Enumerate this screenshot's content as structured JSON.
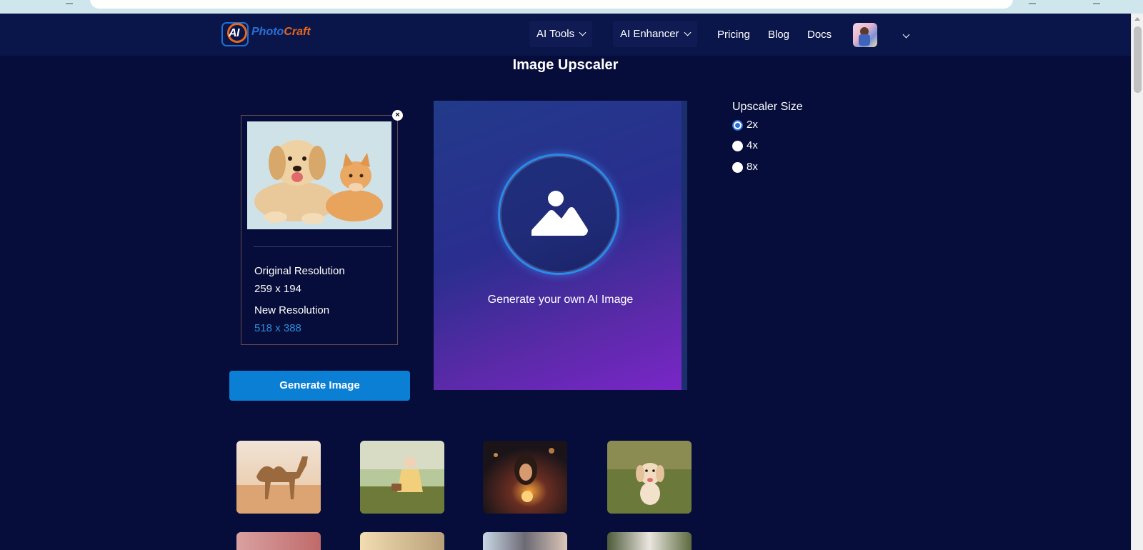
{
  "nav": {
    "logo_ai": "AI",
    "logo_photo": "Photo",
    "logo_craft": "Craft",
    "ai_tools": "AI Tools",
    "ai_enhancer": "AI Enhancer",
    "pricing": "Pricing",
    "blog": "Blog",
    "docs": "Docs"
  },
  "page": {
    "title": "Image Upscaler"
  },
  "upload_card": {
    "close_glyph": "×",
    "original_label": "Original Resolution",
    "original_value": "259 x 194",
    "new_label": "New Resolution",
    "new_value": "518 x 388",
    "new_value_color": "#2d8bd8"
  },
  "generate_button": "Generate Image",
  "preview": {
    "text": "Generate your own AI Image"
  },
  "upscaler": {
    "title": "Upscaler Size",
    "options": [
      {
        "label": "2x",
        "selected": true
      },
      {
        "label": "4x",
        "selected": false
      },
      {
        "label": "8x",
        "selected": false
      }
    ]
  },
  "gallery": {
    "row1": [
      "camel-in-desert",
      "child-in-meadow",
      "woman-with-lights",
      "puppy-on-grass"
    ],
    "row2": [
      "blurry-pink",
      "sunlit-child",
      "two-people",
      "white-flowers"
    ]
  },
  "colors": {
    "background": "#060d3a",
    "navbar": "#0a154a",
    "primary_button": "#0a7fd4",
    "accent_orange": "#e8671b",
    "accent_blue": "#2a6fd6"
  }
}
